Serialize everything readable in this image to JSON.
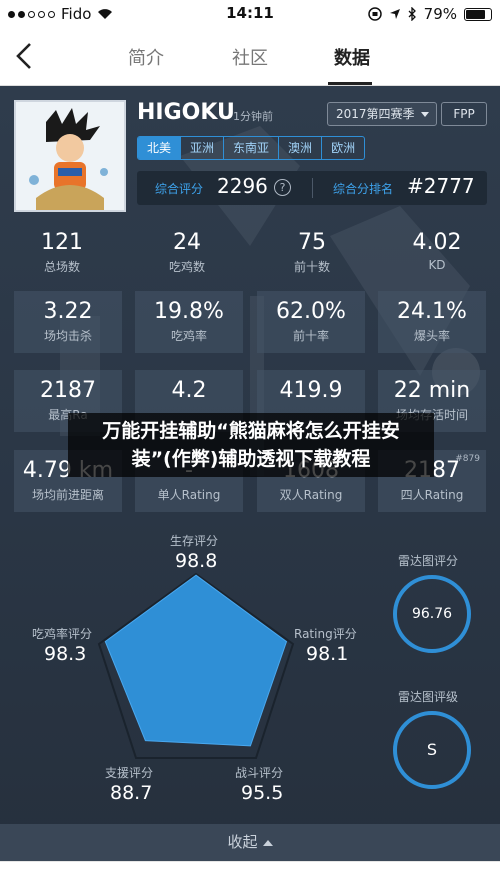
{
  "status": {
    "carrier": "Fido",
    "time": "14:11",
    "battery": "79%",
    "battery_level": 0.79
  },
  "nav": {
    "tabs": [
      {
        "label": "简介"
      },
      {
        "label": "社区"
      },
      {
        "label": "数据"
      }
    ]
  },
  "profile": {
    "name": "HIGOKU",
    "updated": "1分钟前",
    "season": "2017第四赛季",
    "mode": "FPP",
    "regions": [
      "北美",
      "亚洲",
      "东南亚",
      "澳洲",
      "欧洲"
    ],
    "score_label": "综合评分",
    "score_value": "2296",
    "rank_label": "综合分排名",
    "rank_value": "#2777"
  },
  "stats": [
    {
      "value": "121",
      "label": "总场数"
    },
    {
      "value": "24",
      "label": "吃鸡数"
    },
    {
      "value": "75",
      "label": "前十数"
    },
    {
      "value": "4.02",
      "label": "KD"
    },
    {
      "value": "3.22",
      "label": "场均击杀"
    },
    {
      "value": "19.8%",
      "label": "吃鸡率"
    },
    {
      "value": "62.0%",
      "label": "前十率"
    },
    {
      "value": "24.1%",
      "label": "爆头率"
    },
    {
      "value": "2187",
      "label": "最高Ra"
    },
    {
      "value": "4.2",
      "label": ""
    },
    {
      "value": "419.9",
      "label": ""
    },
    {
      "value": "22 min",
      "label": "场均存活时间"
    },
    {
      "value": "4.79 km",
      "label": "场均前进距离"
    },
    {
      "value": "-",
      "label": "单人Rating"
    },
    {
      "value": "1608",
      "label": "双人Rating"
    },
    {
      "value": "2187",
      "label": "四人Rating",
      "rank": "#879"
    }
  ],
  "overlay": {
    "line1": "万能开挂辅助“熊猫麻将怎么开挂安",
    "line2": "装”(作弊)辅助透视下载教程"
  },
  "radar": {
    "axes": [
      {
        "label": "生存评分",
        "value": "98.8"
      },
      {
        "label": "Rating评分",
        "value": "98.1"
      },
      {
        "label": "战斗评分",
        "value": "95.5"
      },
      {
        "label": "支援评分",
        "value": "88.7"
      },
      {
        "label": "吃鸡率评分",
        "value": "98.3"
      }
    ],
    "score_label": "雷达图评分",
    "score_value": "96.76",
    "grade_label": "雷达图评级",
    "grade_value": "S"
  },
  "footer": {
    "collapse_label": "收起"
  },
  "colors": {
    "accent": "#2f8fd6",
    "panel": "#2f3c4c"
  }
}
